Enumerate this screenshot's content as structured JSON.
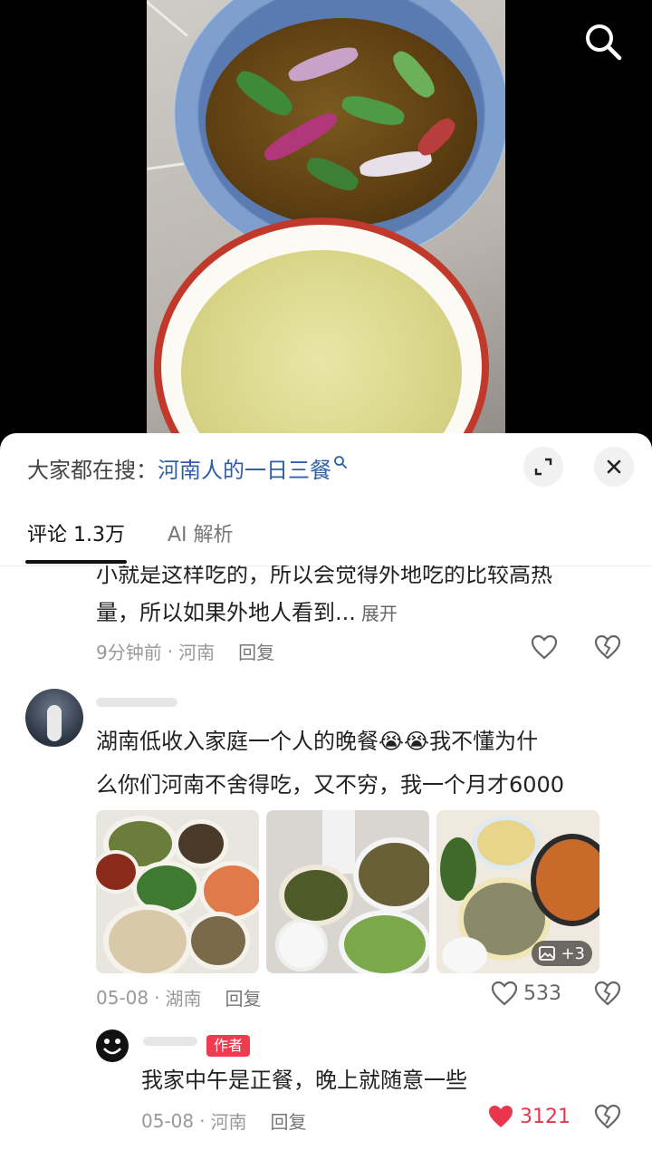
{
  "video": {
    "search_icon": "search-icon"
  },
  "sheet": {
    "hot_search_prefix": "大家都在搜：",
    "hot_search_keyword": "河南人的一日三餐",
    "expand_icon": "expand-icon",
    "close_icon": "close-icon",
    "tabs": [
      {
        "label": "评论 1.3万",
        "active": true
      },
      {
        "label": "AI 解析",
        "active": false
      }
    ]
  },
  "comments": [
    {
      "text_lines": [
        "小就是这样吃的，所以会觉得外地吃的比较高热",
        "量，所以如果外地人看到..."
      ],
      "expand_label": "展开",
      "time": "9分钟前",
      "location": "河南",
      "reply_label": "回复",
      "likes": ""
    },
    {
      "text_lines": [
        "湖南低收入家庭一个人的晚餐",
        "我不懂为什",
        "么你们河南不舍得吃，又不穷，我一个月才6000"
      ],
      "emoji": "😭",
      "images_more": "+3",
      "time": "05-08",
      "location": "湖南",
      "reply_label": "回复",
      "likes": "533"
    },
    {
      "author_badge": "作者",
      "text_lines": [
        "我家中午是正餐，晚上就随意一些"
      ],
      "time": "05-08",
      "location": "河南",
      "reply_label": "回复",
      "likes": "3121",
      "liked": true
    }
  ],
  "colors": {
    "accent_link": "#2f5fa8",
    "like_red": "#e8364d",
    "badge_red": "#f03a4f"
  }
}
